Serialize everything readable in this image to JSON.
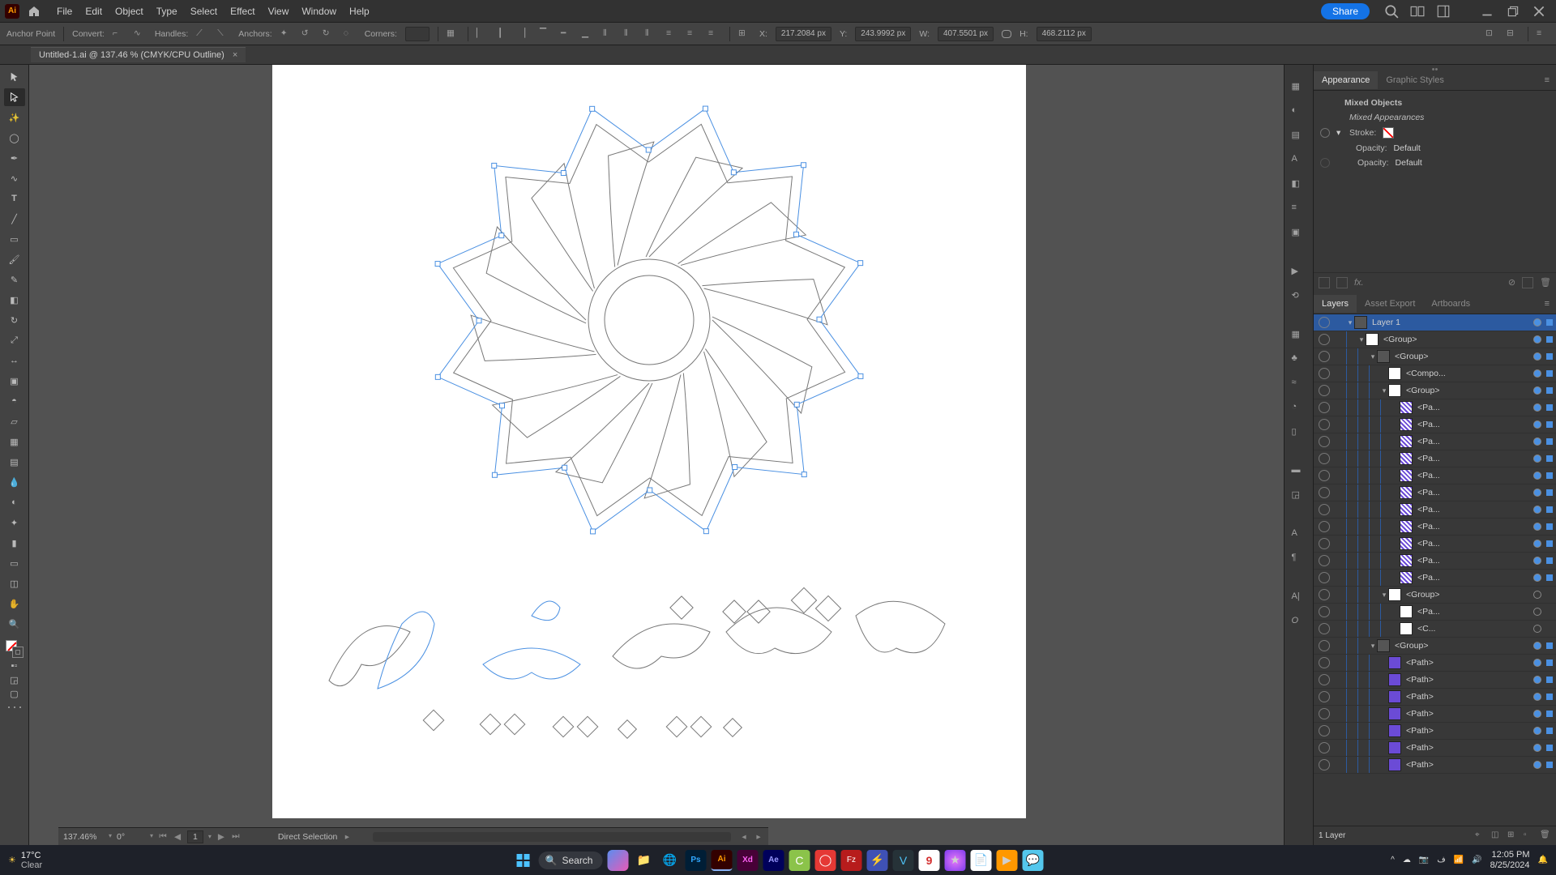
{
  "menubar": {
    "items": [
      "File",
      "Edit",
      "Object",
      "Type",
      "Select",
      "Effect",
      "View",
      "Window",
      "Help"
    ],
    "share": "Share"
  },
  "ctrlbar": {
    "anchor": "Anchor Point",
    "convert": "Convert:",
    "handles": "Handles:",
    "anchors": "Anchors:",
    "corners": "Corners:",
    "x_lbl": "X:",
    "x_val": "217.2084 px",
    "y_lbl": "Y:",
    "y_val": "243.9992 px",
    "w_lbl": "W:",
    "w_val": "407.5501 px",
    "h_lbl": "H:",
    "h_val": "468.2112 px"
  },
  "tab": {
    "title": "Untitled-1.ai @ 137.46 % (CMYK/CPU Outline)"
  },
  "appearance": {
    "tab1": "Appearance",
    "tab2": "Graphic Styles",
    "title": "Mixed Objects",
    "sub": "Mixed Appearances",
    "stroke": "Stroke:",
    "opacity": "Opacity:",
    "opacity_val": "Default",
    "fx": "fx."
  },
  "layersPanel": {
    "tab1": "Layers",
    "tab2": "Asset Export",
    "tab3": "Artboards",
    "footer": "1 Layer",
    "rows": [
      {
        "d": 0,
        "tw": "▾",
        "th": "grp",
        "nm": "Layer 1",
        "top": true,
        "sel": true
      },
      {
        "d": 1,
        "tw": "▾",
        "th": "w",
        "nm": "<Group>",
        "sel": true
      },
      {
        "d": 2,
        "tw": "▾",
        "th": "grp",
        "nm": "<Group>",
        "sel": true
      },
      {
        "d": 3,
        "tw": "",
        "th": "w",
        "nm": "<Compo...",
        "sel": true
      },
      {
        "d": 3,
        "tw": "▾",
        "th": "w",
        "nm": "<Group>",
        "sel": true
      },
      {
        "d": 4,
        "tw": "",
        "th": "hatch",
        "nm": "<Pa...",
        "sel": true
      },
      {
        "d": 4,
        "tw": "",
        "th": "hatch",
        "nm": "<Pa...",
        "sel": true
      },
      {
        "d": 4,
        "tw": "",
        "th": "hatch",
        "nm": "<Pa...",
        "sel": true
      },
      {
        "d": 4,
        "tw": "",
        "th": "hatch",
        "nm": "<Pa...",
        "sel": true
      },
      {
        "d": 4,
        "tw": "",
        "th": "hatch",
        "nm": "<Pa...",
        "sel": true
      },
      {
        "d": 4,
        "tw": "",
        "th": "hatch",
        "nm": "<Pa...",
        "sel": true
      },
      {
        "d": 4,
        "tw": "",
        "th": "hatch",
        "nm": "<Pa...",
        "sel": true
      },
      {
        "d": 4,
        "tw": "",
        "th": "hatch",
        "nm": "<Pa...",
        "sel": true
      },
      {
        "d": 4,
        "tw": "",
        "th": "hatch",
        "nm": "<Pa...",
        "sel": true
      },
      {
        "d": 4,
        "tw": "",
        "th": "hatch",
        "nm": "<Pa...",
        "sel": true
      },
      {
        "d": 4,
        "tw": "",
        "th": "hatch",
        "nm": "<Pa...",
        "sel": true
      },
      {
        "d": 3,
        "tw": "▾",
        "th": "w",
        "nm": "<Group>"
      },
      {
        "d": 4,
        "tw": "",
        "th": "w",
        "nm": "<Pa..."
      },
      {
        "d": 4,
        "tw": "",
        "th": "w",
        "nm": "<C..."
      },
      {
        "d": 2,
        "tw": "▾",
        "th": "grp",
        "nm": "<Group>",
        "sel": true
      },
      {
        "d": 3,
        "tw": "",
        "th": "purple",
        "nm": "<Path>",
        "sel": true
      },
      {
        "d": 3,
        "tw": "",
        "th": "purple",
        "nm": "<Path>",
        "sel": true
      },
      {
        "d": 3,
        "tw": "",
        "th": "purple",
        "nm": "<Path>",
        "sel": true
      },
      {
        "d": 3,
        "tw": "",
        "th": "purple",
        "nm": "<Path>",
        "sel": true
      },
      {
        "d": 3,
        "tw": "",
        "th": "purple",
        "nm": "<Path>",
        "sel": true
      },
      {
        "d": 3,
        "tw": "",
        "th": "purple",
        "nm": "<Path>",
        "sel": true
      },
      {
        "d": 3,
        "tw": "",
        "th": "purple",
        "nm": "<Path>",
        "sel": true
      }
    ]
  },
  "status": {
    "zoom": "137.46%",
    "rot": "0°",
    "page": "1",
    "tool": "Direct Selection"
  },
  "taskbar": {
    "temp": "17°C",
    "cond": "Clear",
    "search": "Search",
    "time": "12:05 PM",
    "date": "8/25/2024"
  }
}
